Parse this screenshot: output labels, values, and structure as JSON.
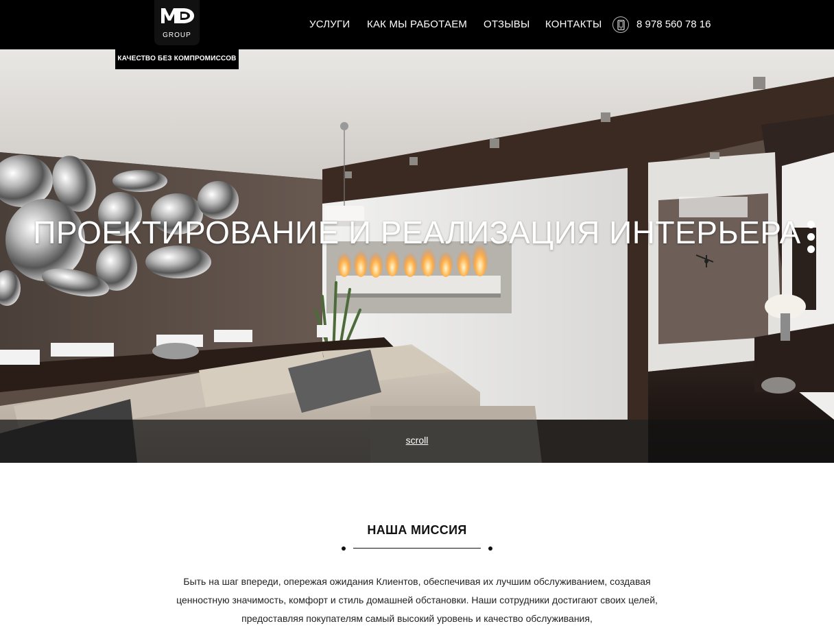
{
  "header": {
    "logo_text": "MD",
    "logo_sub": "GROUP",
    "nav": [
      "УСЛУГИ",
      "КАК МЫ РАБОТАЕМ",
      "ОТЗЫВЫ",
      "КОНТАКТЫ"
    ],
    "phone": "8 978 560 78 16",
    "phone_icon": "phone-icon"
  },
  "tagline": "КАЧЕСТВО БЕЗ КОМПРОМИССОВ",
  "hero": {
    "title": "ПРОЕКТИРОВАНИЕ И РЕАЛИЗАЦИЯ ИНТЕРЬЕРА",
    "scroll_label": "scroll"
  },
  "mission": {
    "title": "НАША МИССИЯ",
    "text": "Быть на шаг впереди, опережая ожидания Клиентов, обеспечивая их лучшим обслуживанием, создавая ценностную значимость, комфорт и стиль домашней обстановки. Наши сотрудники достигают своих целей, предоставляя покупателям самый высокий уровень и качество обслуживания,"
  },
  "colors": {
    "header_bg": "#000000",
    "accent": "#ffffff",
    "text": "#222222"
  }
}
